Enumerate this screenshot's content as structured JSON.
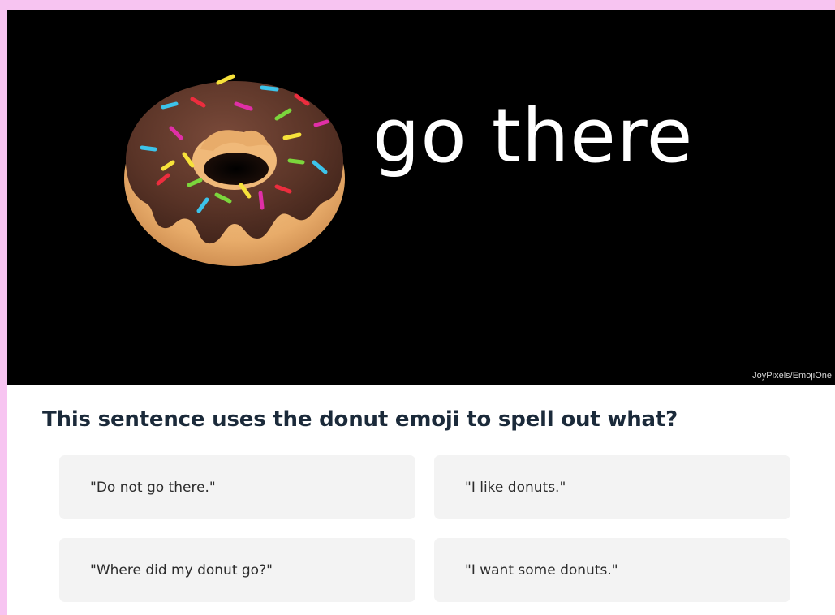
{
  "colors": {
    "page_background": "#f7c4f1",
    "hero_background": "#000000",
    "question_text": "#1b2a3a",
    "answer_background": "#f3f3f3",
    "icing": "#5a3427",
    "dough": "#e8b071"
  },
  "hero": {
    "image_icon": "donut-emoji",
    "text": "go there",
    "credit": "JoyPixels/EmojiOne"
  },
  "question": {
    "text": "This sentence uses the donut emoji to spell out what?"
  },
  "answers": [
    {
      "label": "\"Do not go there.\""
    },
    {
      "label": "\"I like donuts.\""
    },
    {
      "label": "\"Where did my donut go?\""
    },
    {
      "label": "\"I want some donuts.\""
    }
  ]
}
